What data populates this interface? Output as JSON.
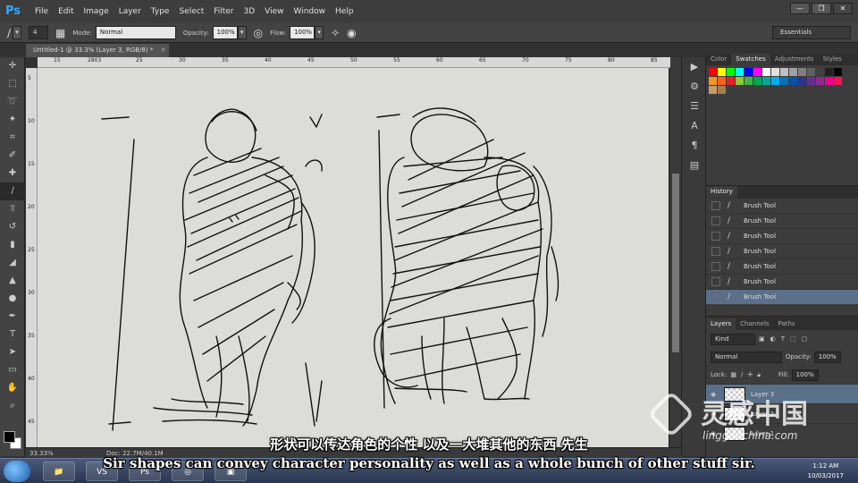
{
  "app": {
    "logo": "Ps"
  },
  "menu": [
    "File",
    "Edit",
    "Image",
    "Layer",
    "Type",
    "Select",
    "Filter",
    "3D",
    "View",
    "Window",
    "Help"
  ],
  "window_controls": [
    "—",
    "❐",
    "✕"
  ],
  "options": {
    "brush_size": "4",
    "mode_label": "Mode:",
    "mode_value": "Normal",
    "opacity_label": "Opacity:",
    "opacity_value": "100%",
    "flow_label": "Flow:",
    "flow_value": "100%",
    "workspace": "Essentials"
  },
  "document": {
    "tab_title": "Untitled-1 @ 33.3% (Layer 3, RGB/8) *",
    "zoom": "33.33%",
    "doc_size": "Doc: 22.7M/40.1M"
  },
  "ruler_h": [
    "15",
    "2803",
    "25",
    "30",
    "35",
    "40",
    "45",
    "50",
    "55",
    "60",
    "65",
    "70",
    "75",
    "80",
    "85"
  ],
  "ruler_v": [
    "5",
    "10",
    "15",
    "20",
    "25",
    "30",
    "35",
    "40",
    "45"
  ],
  "swatches_panel": {
    "tabs": [
      "Color",
      "Swatches",
      "Adjustments",
      "Styles"
    ],
    "colors": [
      "#ff0000",
      "#ffff00",
      "#00ff00",
      "#00ffff",
      "#0000ff",
      "#ff00ff",
      "#ffffff",
      "#e0e0e0",
      "#c0c0c0",
      "#a0a0a0",
      "#808080",
      "#606060",
      "#404040",
      "#202020",
      "#000000",
      "#f7941d",
      "#f26522",
      "#ed1c24",
      "#8dc63f",
      "#39b54a",
      "#00a651",
      "#00a99d",
      "#00aeef",
      "#0072bc",
      "#0054a6",
      "#2e3192",
      "#662d91",
      "#92278f",
      "#ec008c",
      "#ed145b",
      "#c69c6d",
      "#a67c52"
    ]
  },
  "history_panel": {
    "tab": "History",
    "items": [
      "Brush Tool",
      "Brush Tool",
      "Brush Tool",
      "Brush Tool",
      "Brush Tool",
      "Brush Tool",
      "Brush Tool"
    ]
  },
  "layers_panel": {
    "tabs": [
      "Layers",
      "Channels",
      "Paths"
    ],
    "kind_label": "Kind",
    "blend_mode": "Normal",
    "opacity_label": "Opacity:",
    "opacity_value": "100%",
    "lock_label": "Lock:",
    "fill_label": "Fill:",
    "fill_value": "100%",
    "layers": [
      {
        "name": "Layer 3"
      },
      {
        "name": "Layer 2"
      },
      {
        "name": "Layer 1"
      }
    ]
  },
  "subtitles": {
    "chinese": "形状可以传达角色的个性 以及一大堆其他的东西 先生",
    "english": "Sir shapes can convey character personality as well as a whole bunch of other stuff sir."
  },
  "watermark": {
    "chinese": "灵感中国",
    "url": "lingganchina.com"
  },
  "taskbar": {
    "apps": [
      "📁",
      "VS",
      "Ps",
      "◎",
      "▣"
    ],
    "time": "1:12 AM",
    "date": "10/03/2017"
  }
}
